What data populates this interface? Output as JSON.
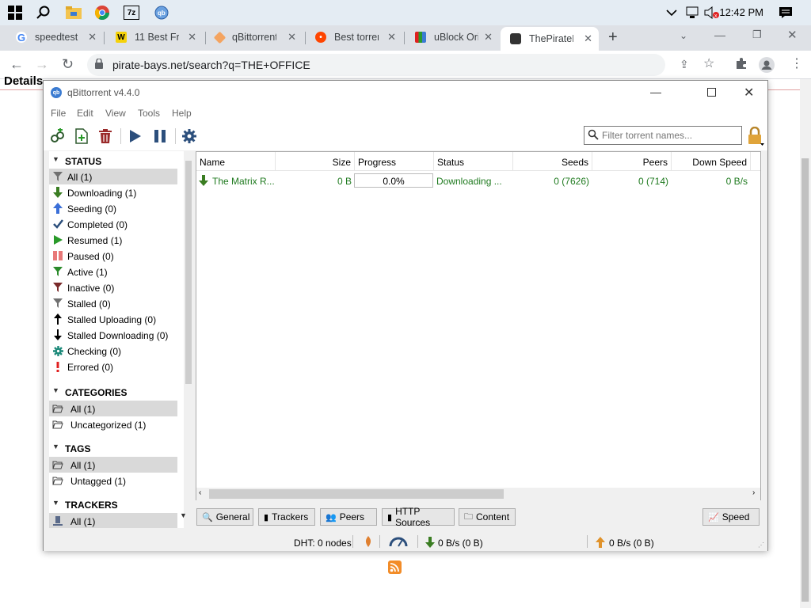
{
  "taskbar": {
    "icons": [
      "windows-start-icon",
      "search-icon",
      "file-explorer-icon",
      "chrome-icon",
      "7zip-icon",
      "qbittorrent-icon"
    ],
    "sevenzip_label": "7z",
    "clock": "12:42 PM"
  },
  "browser": {
    "tabs": [
      {
        "label": "speedtest -",
        "icon": "google-icon"
      },
      {
        "label": "11 Best Fre",
        "icon": "w-icon"
      },
      {
        "label": "qBittorrent",
        "icon": "diamond-icon"
      },
      {
        "label": "Best torren",
        "icon": "reddit-icon"
      },
      {
        "label": "uBlock Orig",
        "icon": "ublock-icon"
      },
      {
        "label": "ThePirateB",
        "icon": "pirate-icon",
        "active": true
      }
    ],
    "new_tab": "+",
    "url": "pirate-bays.net/search?q=THE+OFFICE"
  },
  "page": {
    "header_text": "Details"
  },
  "qbittorrent": {
    "title": "qBittorrent v4.4.0",
    "menu": [
      "File",
      "Edit",
      "View",
      "Tools",
      "Help"
    ],
    "filter_placeholder": "Filter torrent names...",
    "sidebar": {
      "status_title": "STATUS",
      "status_items": [
        {
          "label": "All (1)",
          "icon": "filter-icon",
          "color": "#707070",
          "selected": true
        },
        {
          "label": "Downloading (1)",
          "icon": "download-arrow-icon",
          "color": "#3a7d22"
        },
        {
          "label": "Seeding (0)",
          "icon": "upload-arrow-icon",
          "color": "#3a6fd8"
        },
        {
          "label": "Completed (0)",
          "icon": "checkmark-icon",
          "color": "#2c4f7c"
        },
        {
          "label": "Resumed (1)",
          "icon": "play-icon",
          "color": "#2a9a2a"
        },
        {
          "label": "Paused (0)",
          "icon": "pause-icon",
          "color": "#e87878"
        },
        {
          "label": "Active (1)",
          "icon": "filter-active-icon",
          "color": "#2a8a2a"
        },
        {
          "label": "Inactive (0)",
          "icon": "filter-inactive-icon",
          "color": "#7a2a2a"
        },
        {
          "label": "Stalled (0)",
          "icon": "filter-stalled-icon",
          "color": "#707070"
        },
        {
          "label": "Stalled Uploading (0)",
          "icon": "stalled-upload-icon",
          "color": "#000000"
        },
        {
          "label": "Stalled Downloading (0)",
          "icon": "stalled-download-icon",
          "color": "#000000"
        },
        {
          "label": "Checking (0)",
          "icon": "gear-icon",
          "color": "#1d8a7a"
        },
        {
          "label": "Errored (0)",
          "icon": "exclamation-icon",
          "color": "#e02020"
        }
      ],
      "categories_title": "CATEGORIES",
      "category_items": [
        {
          "label": "All (1)",
          "selected": true
        },
        {
          "label": "Uncategorized (1)"
        }
      ],
      "tags_title": "TAGS",
      "tag_items": [
        {
          "label": "All (1)",
          "selected": true
        },
        {
          "label": "Untagged (1)"
        }
      ],
      "trackers_title": "TRACKERS",
      "tracker_items": [
        {
          "label": "All (1)",
          "selected": true
        }
      ]
    },
    "table": {
      "columns": [
        "Name",
        "Size",
        "Progress",
        "Status",
        "Seeds",
        "Peers",
        "Down Speed"
      ],
      "rows": [
        {
          "name": "The Matrix R...",
          "size": "0 B",
          "progress": "0.0%",
          "status": "Downloading ...",
          "seeds": "0 (7626)",
          "peers": "0 (714)",
          "down_speed": "0 B/s"
        }
      ]
    },
    "bottom_tabs": [
      "General",
      "Trackers",
      "Peers",
      "HTTP Sources",
      "Content"
    ],
    "speed_button": "Speed",
    "statusbar": {
      "dht": "DHT: 0 nodes",
      "down": "0 B/s (0 B)",
      "up": "0 B/s (0 B)"
    }
  }
}
